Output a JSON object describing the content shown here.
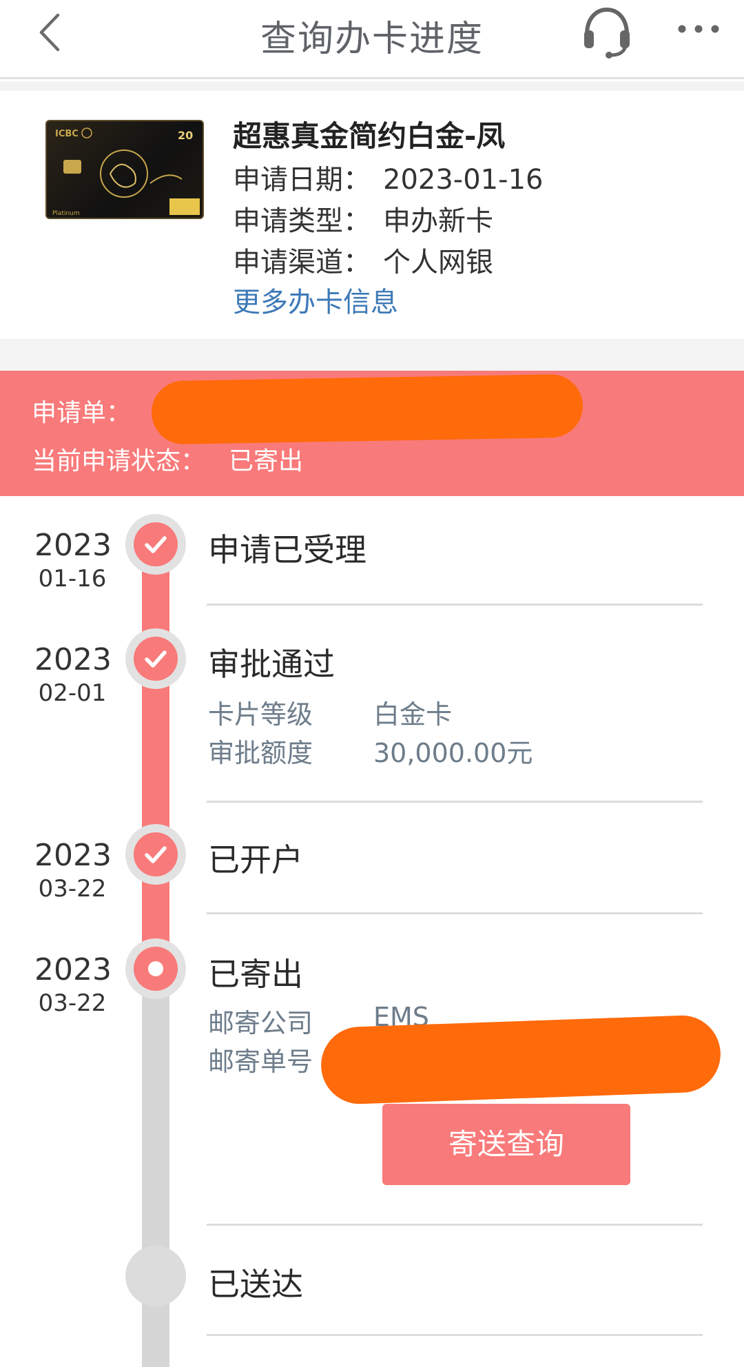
{
  "header": {
    "title": "查询办卡进度"
  },
  "card": {
    "name": "超惠真金简约白金-凤",
    "date_label": "申请日期：",
    "date_value": "2023-01-16",
    "type_label": "申请类型：",
    "type_value": "申办新卡",
    "channel_label": "申请渠道：",
    "channel_value": "个人网银",
    "more_info": "更多办卡信息"
  },
  "status": {
    "application_label": "申请单：",
    "state_label": "当前申请状态：",
    "state_value": "已寄出"
  },
  "timeline": [
    {
      "year": "2023",
      "md": "01-16",
      "title": "申请已受理",
      "done": true
    },
    {
      "year": "2023",
      "md": "02-01",
      "title": "审批通过",
      "done": true,
      "details": [
        {
          "label": "卡片等级",
          "value": "白金卡"
        },
        {
          "label": "审批额度",
          "value": "30,000.00元"
        }
      ]
    },
    {
      "year": "2023",
      "md": "03-22",
      "title": "已开户",
      "done": true
    },
    {
      "year": "2023",
      "md": "03-22",
      "title": "已寄出",
      "done": false,
      "current": true,
      "details": [
        {
          "label": "邮寄公司",
          "value": "EMS"
        },
        {
          "label": "邮寄单号",
          "value": ""
        }
      ],
      "button": "寄送查询"
    },
    {
      "year": "",
      "md": "",
      "title": "已送达",
      "done": false
    }
  ],
  "colors": {
    "accent": "#f97a7a",
    "link": "#3d79b7",
    "redaction": "#ff6a0a"
  },
  "icons": {
    "back": "chevron-left-icon",
    "service": "headset-icon",
    "more": "more-dots-icon",
    "check": "check-icon"
  }
}
